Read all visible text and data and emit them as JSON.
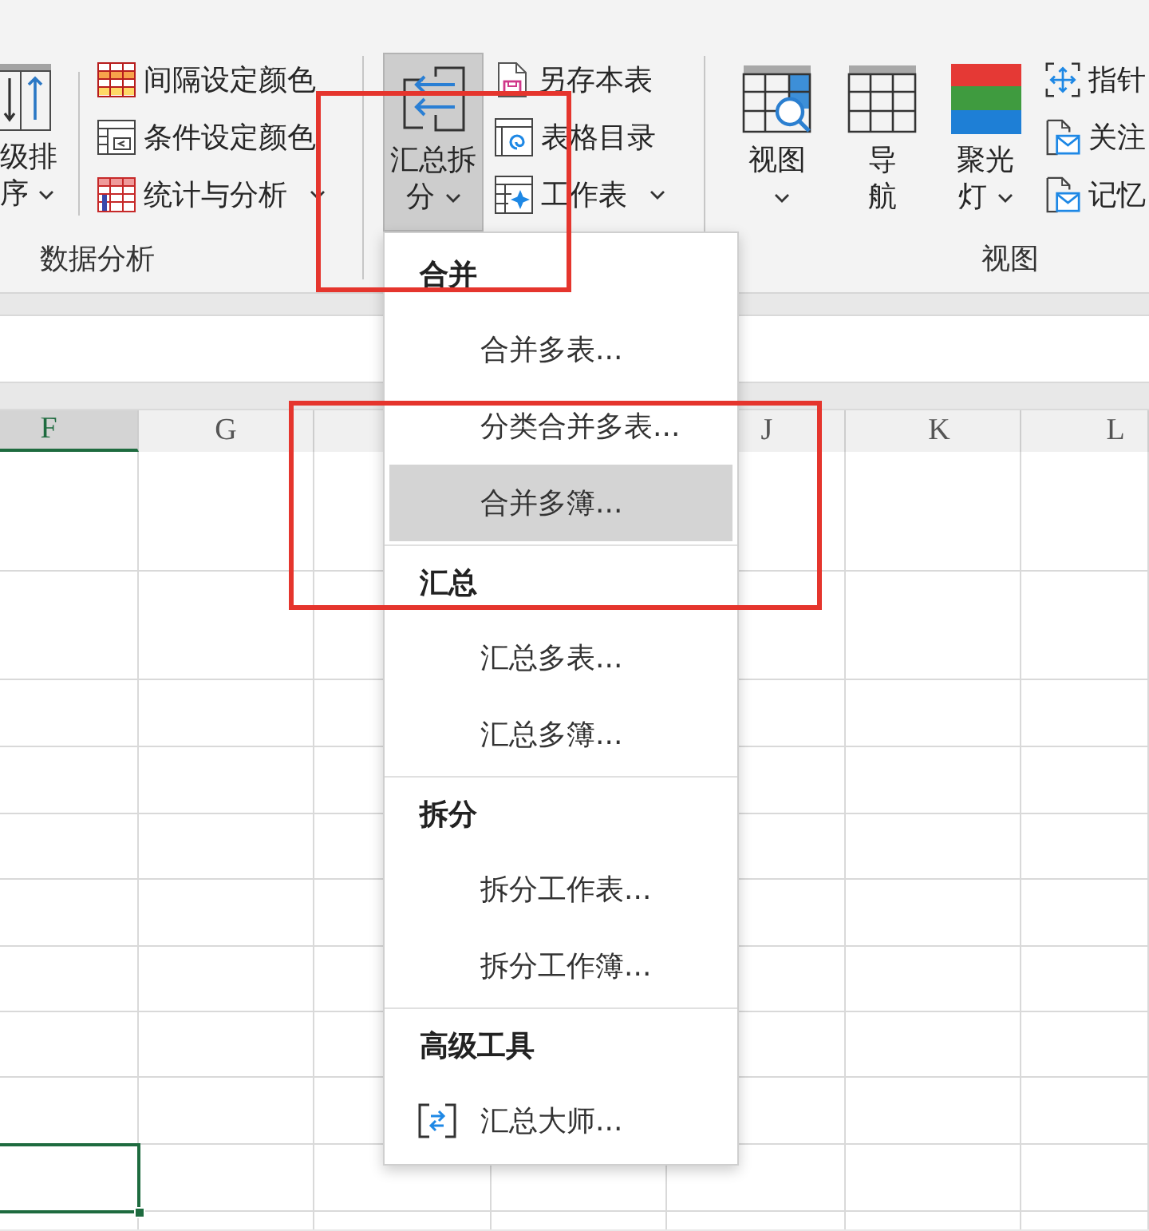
{
  "ribbon": {
    "groups": [
      {
        "label": "数据分析",
        "items": [
          {
            "kind": "large",
            "label": "级排序",
            "has_menu": true,
            "pressed": false
          },
          {
            "kind": "small",
            "label": "间隔设定颜色",
            "has_menu": false,
            "pressed": false
          },
          {
            "kind": "small",
            "label": "条件设定颜色",
            "has_menu": false,
            "pressed": false
          },
          {
            "kind": "small",
            "label": "统计与分析",
            "has_menu": true,
            "pressed": false
          }
        ]
      },
      {
        "items": [
          {
            "kind": "large",
            "label": "汇总拆分",
            "has_menu": true,
            "pressed": true
          },
          {
            "kind": "small",
            "label": "另存本表",
            "has_menu": false,
            "pressed": false
          },
          {
            "kind": "small",
            "label": "表格目录",
            "has_menu": false,
            "pressed": false
          },
          {
            "kind": "small",
            "label": "工作表",
            "has_menu": true,
            "pressed": false
          }
        ]
      },
      {
        "label": "视图",
        "items": [
          {
            "kind": "large",
            "label": "视图",
            "has_menu": true,
            "pressed": false
          },
          {
            "kind": "large",
            "label": "导航",
            "has_menu": false,
            "pressed": false
          },
          {
            "kind": "large",
            "label": "聚光灯",
            "has_menu": true,
            "pressed": false
          },
          {
            "kind": "small",
            "label": "指针",
            "has_menu": false,
            "pressed": false
          },
          {
            "kind": "small",
            "label": "关注",
            "has_menu": false,
            "pressed": false
          },
          {
            "kind": "small",
            "label": "记忆",
            "has_menu": false,
            "pressed": false
          }
        ]
      }
    ]
  },
  "sheet": {
    "columns": [
      {
        "label": "F",
        "selected": true
      },
      {
        "label": "G",
        "selected": false
      },
      {
        "label": "J",
        "selected": false
      },
      {
        "label": "K",
        "selected": false
      },
      {
        "label": "L",
        "selected": false
      }
    ]
  },
  "dropdown_menu": {
    "sections": [
      {
        "heading": "合并",
        "items": [
          {
            "label": "合并多表...",
            "selected": false
          },
          {
            "label": "分类合并多表...",
            "selected": false
          },
          {
            "label": "合并多簿...",
            "selected": true
          }
        ]
      },
      {
        "heading": "汇总",
        "items": [
          {
            "label": "汇总多表...",
            "selected": false
          },
          {
            "label": "汇总多簿...",
            "selected": false
          }
        ]
      },
      {
        "heading": "拆分",
        "items": [
          {
            "label": "拆分工作表...",
            "selected": false
          },
          {
            "label": "拆分工作簿...",
            "selected": false
          }
        ]
      },
      {
        "heading": "高级工具",
        "items": [
          {
            "label": "汇总大师...",
            "selected": false
          }
        ]
      }
    ]
  }
}
